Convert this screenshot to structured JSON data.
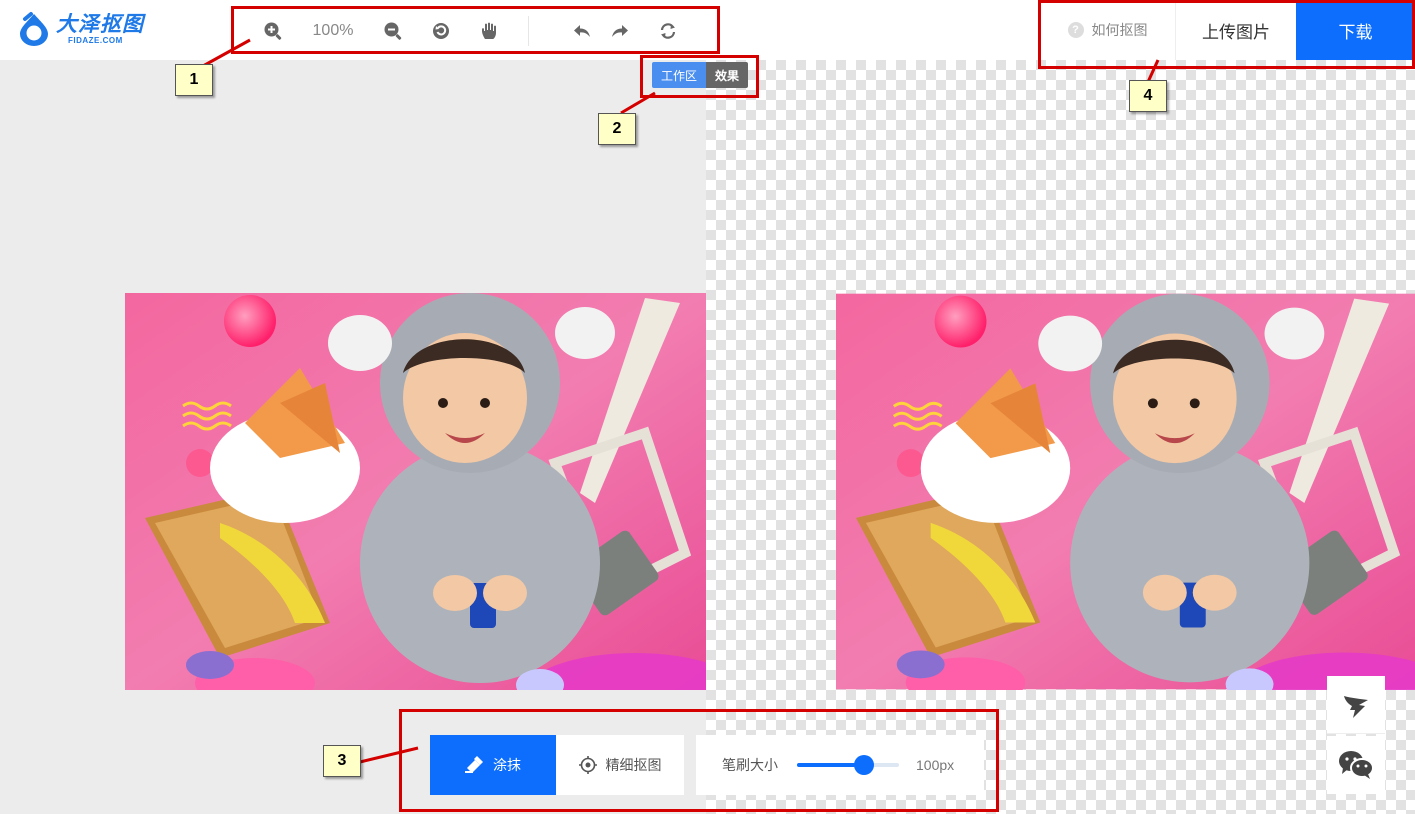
{
  "brand": {
    "name_cn": "大泽抠图",
    "name_en": "FIDAZE.COM",
    "color": "#1f7ae8"
  },
  "toolbar": {
    "zoom_level": "100%",
    "icons": [
      "zoom-in-icon",
      "zoom-out-icon",
      "reset-icon",
      "hand-icon",
      "undo-icon",
      "redo-icon",
      "swap-icon"
    ]
  },
  "header": {
    "help_label": "如何抠图",
    "upload_label": "上传图片",
    "download_label": "下载"
  },
  "view_toggle": {
    "work_label": "工作区",
    "effect_label": "效果"
  },
  "tools": {
    "smear_label": "涂抹",
    "fine_label": "精细抠图",
    "brush_label": "笔刷大小",
    "brush_value": "100px",
    "brush_fraction": 0.66
  },
  "annotations": [
    "1",
    "2",
    "3",
    "4"
  ],
  "colors": {
    "accent": "#0d6efd",
    "annotation": "#d40000"
  }
}
